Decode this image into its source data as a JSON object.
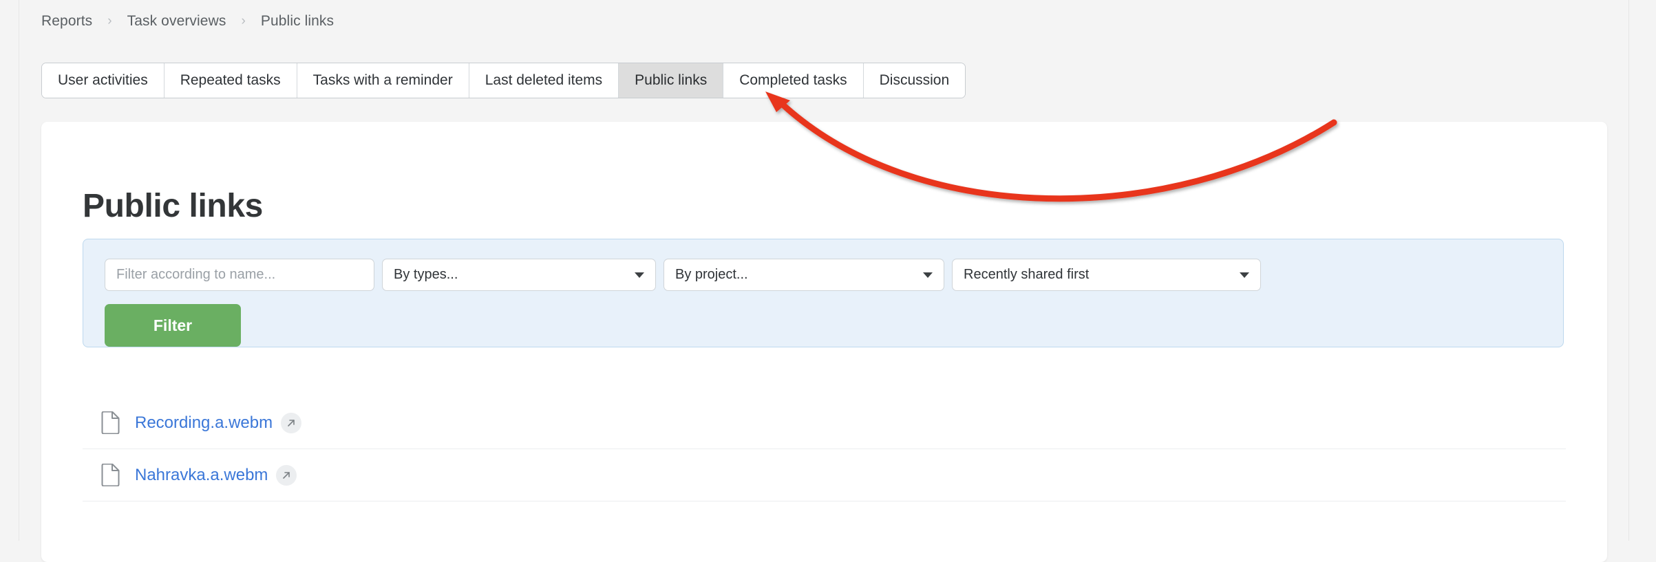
{
  "breadcrumb": {
    "separator": "›",
    "items": [
      {
        "label": "Reports"
      },
      {
        "label": "Task overviews"
      },
      {
        "label": "Public links"
      }
    ]
  },
  "tabs": {
    "active": "Public links",
    "items": [
      {
        "label": "User activities"
      },
      {
        "label": "Repeated tasks"
      },
      {
        "label": "Tasks with a reminder"
      },
      {
        "label": "Last deleted items"
      },
      {
        "label": "Public links"
      },
      {
        "label": "Completed tasks"
      },
      {
        "label": "Discussion"
      }
    ]
  },
  "page": {
    "title": "Public links"
  },
  "filter": {
    "name_placeholder": "Filter according to name...",
    "name_value": "",
    "types_label": "By types...",
    "project_label": "By project...",
    "sort_label": "Recently shared first",
    "submit_label": "Filter",
    "panel_bg": "#e8f1fa",
    "panel_border": "#bdd8ee",
    "button_color": "#6aaf62"
  },
  "links": [
    {
      "name": "Recording.a.webm",
      "icon": "file-icon",
      "action_icon": "external-link-icon"
    },
    {
      "name": "Nahravka.a.webm",
      "icon": "file-icon",
      "action_icon": "external-link-icon"
    }
  ],
  "annotation": {
    "type": "curved-arrow",
    "color": "#e8341f",
    "points_to": "Public links"
  },
  "colors": {
    "page_background": "#f4f4f4",
    "card_background": "#ffffff",
    "link_text": "#3b77d8",
    "active_tab": "#dddddd"
  }
}
